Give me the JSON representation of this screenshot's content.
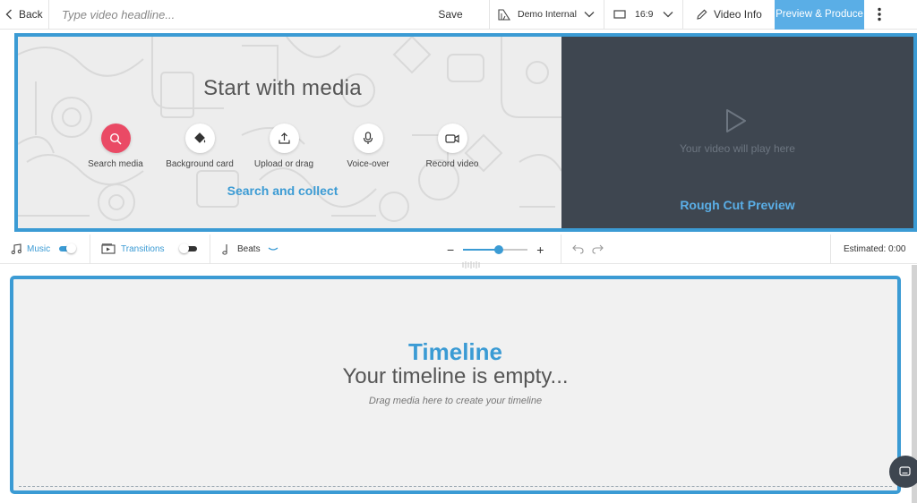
{
  "topbar": {
    "back_label": "Back",
    "headline_placeholder": "Type video headline...",
    "save_label": "Save",
    "workspace_label": "Demo Internal",
    "aspect_ratio_label": "16:9",
    "video_info_label": "Video Info",
    "produce_label": "Preview & Produce"
  },
  "media": {
    "title": "Start with media",
    "tools": [
      {
        "label": "Search media",
        "icon": "search-icon"
      },
      {
        "label": "Background card",
        "icon": "paint-bucket-icon"
      },
      {
        "label": "Upload or drag",
        "icon": "upload-icon"
      },
      {
        "label": "Voice-over",
        "icon": "microphone-icon"
      },
      {
        "label": "Record video",
        "icon": "video-camera-icon"
      }
    ],
    "collect_label": "Search and collect"
  },
  "preview": {
    "placeholder": "Your video will play here",
    "title": "Rough Cut Preview"
  },
  "controls": {
    "music_label": "Music",
    "transitions_label": "Transitions",
    "beats_label": "Beats",
    "zoom_minus": "−",
    "zoom_plus": "+",
    "zoom_level": 0.55,
    "estimated_label": "Estimated: 0:00"
  },
  "timeline": {
    "title": "Timeline",
    "empty_message": "Your timeline is empty...",
    "hint": "Drag media here to create your timeline"
  },
  "colors": {
    "accent": "#3b9bd4",
    "produce": "#5aaee6",
    "search_active": "#ea4a65",
    "preview_bg": "#3e4650"
  }
}
